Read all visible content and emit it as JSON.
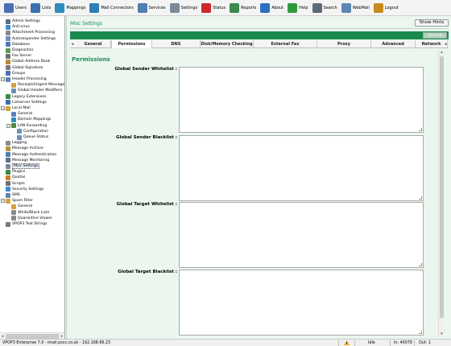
{
  "toolbar": {
    "items": [
      {
        "label": "Users",
        "icon": "users-icon",
        "color": "#4a6fb5"
      },
      {
        "label": "Lists",
        "icon": "lists-icon",
        "color": "#3b6fb0"
      },
      {
        "label": "Mappings",
        "icon": "mappings-icon",
        "color": "#2f8bc0"
      },
      {
        "label": "Mail Connectors",
        "icon": "mail-connectors-icon",
        "color": "#2f7fb8"
      },
      {
        "label": "Services",
        "icon": "services-icon",
        "color": "#4e7fb0"
      },
      {
        "label": "Settings",
        "icon": "settings-icon",
        "color": "#7d8a96"
      },
      {
        "label": "Status",
        "icon": "status-icon",
        "color": "#cc2a2a"
      },
      {
        "label": "Reports",
        "icon": "reports-icon",
        "color": "#3a8a4a"
      },
      {
        "label": "About",
        "icon": "about-icon",
        "color": "#2c6fbf"
      },
      {
        "label": "Help",
        "icon": "help-icon",
        "color": "#2e9a3a"
      },
      {
        "label": "Search",
        "icon": "search-icon",
        "color": "#5a6a7a"
      },
      {
        "label": "WebMail",
        "icon": "webmail-icon",
        "color": "#5f86b4"
      },
      {
        "label": "Logout",
        "icon": "logout-icon",
        "color": "#c78b1d"
      }
    ]
  },
  "tree": {
    "items": [
      {
        "label": "Admin Settings",
        "icon": "admin-settings-icon",
        "color": "#5b6f8a",
        "indent": 0,
        "expander": ""
      },
      {
        "label": "Anti-virus",
        "icon": "anti-virus-icon",
        "color": "#3e8ad0",
        "indent": 0,
        "expander": ""
      },
      {
        "label": "Attachment Processing",
        "icon": "attachment-icon",
        "color": "#8a8a8a",
        "indent": 0,
        "expander": ""
      },
      {
        "label": "Autoresponder Settings",
        "icon": "autoresponder-icon",
        "color": "#6d8fb8",
        "indent": 0,
        "expander": ""
      },
      {
        "label": "Database",
        "icon": "database-icon",
        "color": "#4b7db5",
        "indent": 0,
        "expander": ""
      },
      {
        "label": "Diagnostics",
        "icon": "diagnostics-icon",
        "color": "#5c9a52",
        "indent": 0,
        "expander": ""
      },
      {
        "label": "Fax Server",
        "icon": "fax-server-icon",
        "color": "#6f6f6f",
        "indent": 0,
        "expander": ""
      },
      {
        "label": "Global Address Book",
        "icon": "address-book-icon",
        "color": "#b88b3a",
        "indent": 0,
        "expander": ""
      },
      {
        "label": "Global Signature",
        "icon": "signature-icon",
        "color": "#7a7a7a",
        "indent": 0,
        "expander": ""
      },
      {
        "label": "Groups",
        "icon": "groups-icon",
        "color": "#4a6fb5",
        "indent": 0,
        "expander": ""
      },
      {
        "label": "Header Processing",
        "icon": "header-processing-icon",
        "color": "#5b84b8",
        "indent": 0,
        "expander": "−"
      },
      {
        "label": "Receipts/Urgent Messages",
        "icon": "receipts-icon",
        "color": "#d0a34a",
        "indent": 1,
        "expander": ""
      },
      {
        "label": "Global Header Modifiers",
        "icon": "header-modifiers-icon",
        "color": "#6f8fb0",
        "indent": 1,
        "expander": ""
      },
      {
        "label": "Legacy Extensions",
        "icon": "legacy-extensions-icon",
        "color": "#3a8a4a",
        "indent": 0,
        "expander": ""
      },
      {
        "label": "Listserver Settings",
        "icon": "listserver-icon",
        "color": "#3b6fb0",
        "indent": 0,
        "expander": ""
      },
      {
        "label": "Local Mail",
        "icon": "local-mail-icon",
        "color": "#d3a236",
        "indent": 0,
        "expander": "−"
      },
      {
        "label": "General",
        "icon": "general-icon",
        "color": "#5a84b6",
        "indent": 1,
        "expander": ""
      },
      {
        "label": "Domain Mappings",
        "icon": "domain-mappings-icon",
        "color": "#2f8bc0",
        "indent": 1,
        "expander": ""
      },
      {
        "label": "LAN Forwarding",
        "icon": "lan-forwarding-icon",
        "color": "#4a8a3a",
        "indent": 1,
        "expander": "−"
      },
      {
        "label": "Configuration",
        "icon": "configuration-icon",
        "color": "#6d8fb8",
        "indent": 2,
        "expander": ""
      },
      {
        "label": "Queue Status",
        "icon": "queue-status-icon",
        "color": "#6d8fb8",
        "indent": 2,
        "expander": ""
      },
      {
        "label": "Logging",
        "icon": "logging-icon",
        "color": "#8a8a8a",
        "indent": 0,
        "expander": ""
      },
      {
        "label": "Message Archive",
        "icon": "message-archive-icon",
        "color": "#b8923a",
        "indent": 0,
        "expander": ""
      },
      {
        "label": "Message Authentication",
        "icon": "message-auth-icon",
        "color": "#4b7db5",
        "indent": 0,
        "expander": ""
      },
      {
        "label": "Message Monitoring",
        "icon": "message-monitoring-icon",
        "color": "#5b6f8a",
        "indent": 0,
        "expander": ""
      },
      {
        "label": "Misc Settings",
        "icon": "misc-settings-icon",
        "color": "#7d8a96",
        "indent": 0,
        "expander": "",
        "selected": true
      },
      {
        "label": "Plugins",
        "icon": "plugins-icon",
        "color": "#3a8a4a",
        "indent": 0,
        "expander": ""
      },
      {
        "label": "Quotas",
        "icon": "quotas-icon",
        "color": "#d07a2a",
        "indent": 0,
        "expander": ""
      },
      {
        "label": "Scripts",
        "icon": "scripts-icon",
        "color": "#6f6f6f",
        "indent": 0,
        "expander": ""
      },
      {
        "label": "Security Settings",
        "icon": "security-settings-icon",
        "color": "#3e8ad0",
        "indent": 0,
        "expander": ""
      },
      {
        "label": "SMS",
        "icon": "sms-icon",
        "color": "#5f86b4",
        "indent": 0,
        "expander": ""
      },
      {
        "label": "Spam Filter",
        "icon": "spam-filter-icon",
        "color": "#d3a236",
        "indent": 0,
        "expander": "−"
      },
      {
        "label": "General",
        "icon": "general-icon",
        "color": "#d3a236",
        "indent": 1,
        "expander": ""
      },
      {
        "label": "White/Black Lists",
        "icon": "white-black-lists-icon",
        "color": "#8a8a8a",
        "indent": 1,
        "expander": ""
      },
      {
        "label": "Quarantine Viewer",
        "icon": "quarantine-viewer-icon",
        "color": "#8a8a8a",
        "indent": 1,
        "expander": ""
      },
      {
        "label": "VPOP3 Text Strings",
        "icon": "text-strings-icon",
        "color": "#7a7a7a",
        "indent": 0,
        "expander": ""
      }
    ]
  },
  "content": {
    "page_title": "Misc Settings",
    "show_hints_label": "Show Hints",
    "submit_label": "Submit",
    "tabs": [
      {
        "label": "General",
        "active": false
      },
      {
        "label": "Permissions",
        "active": true
      },
      {
        "label": "DNS",
        "active": false
      },
      {
        "label": "Disk/Memory Checking",
        "active": false
      },
      {
        "label": "External Fax",
        "active": false
      },
      {
        "label": "Proxy",
        "active": false
      },
      {
        "label": "Advanced",
        "active": false
      },
      {
        "label": "Network",
        "active": false
      }
    ],
    "section_title": "Permissions",
    "fields": [
      {
        "label": "Global Sender Whitelist :",
        "value": ""
      },
      {
        "label": "Global Sender Blacklist :",
        "value": ""
      },
      {
        "label": "Global Target Whitelist :",
        "value": ""
      },
      {
        "label": "Global Target Blacklist :",
        "value": ""
      }
    ]
  },
  "statusbar": {
    "server": "VPOP3 Enterprise 7.0 - imail.pscs.co.uk - 192.168.66.23",
    "state": "Idle",
    "in_label": "In: 40079",
    "out_label": "Out: 1"
  },
  "colors": {
    "accent_green": "#188a4e",
    "title_green": "#1e8c55",
    "content_bg": "#eaf6ee"
  }
}
